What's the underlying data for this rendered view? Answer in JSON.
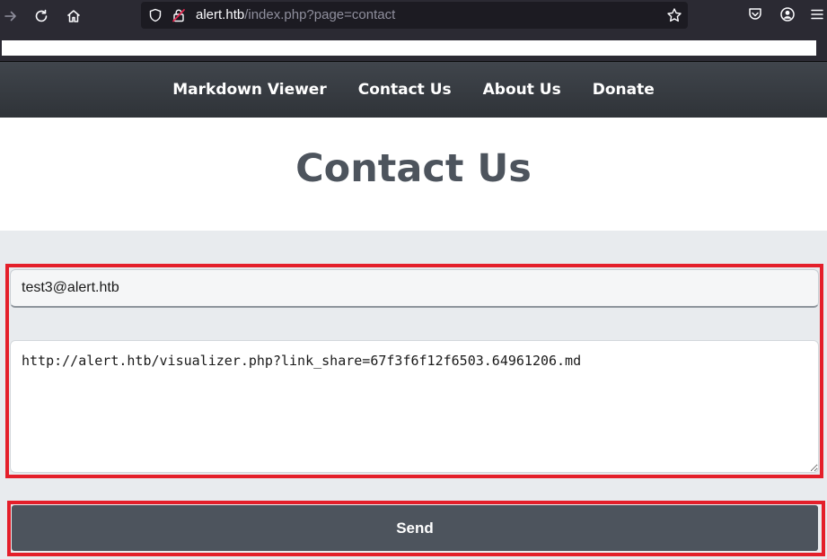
{
  "browser": {
    "url_host": "alert.htb",
    "url_path": "/index.php?page=contact"
  },
  "nav": {
    "items": [
      "Markdown Viewer",
      "Contact Us",
      "About Us",
      "Donate"
    ]
  },
  "page": {
    "title": "Contact Us"
  },
  "form": {
    "email_value": "test3@alert.htb",
    "message_value": "http://alert.htb/visualizer.php?link_share=67f3f6f12f6503.64961206.md",
    "send_label": "Send"
  },
  "colors": {
    "highlight": "#e41f2a",
    "nav_bg": "#3a3f45",
    "button_bg": "#4d545d",
    "title": "#4d545d"
  }
}
